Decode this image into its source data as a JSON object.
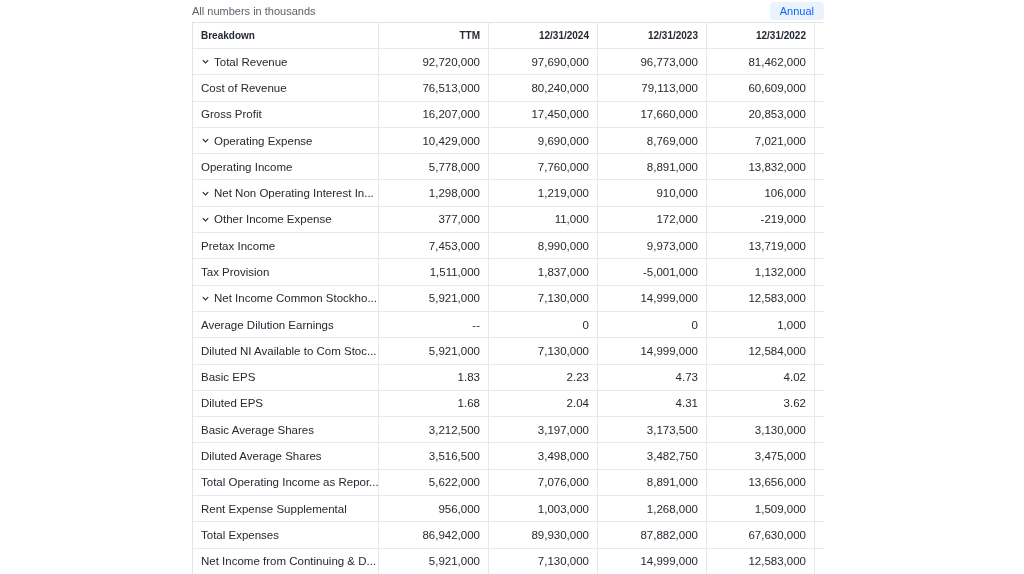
{
  "caption": "All numbers in thousands",
  "period_button": {
    "label": "Annual",
    "selected": true
  },
  "table": {
    "columns": [
      "Breakdown",
      "TTM",
      "12/31/2024",
      "12/31/2023",
      "12/31/2022"
    ],
    "rows": [
      {
        "label": "Total Revenue",
        "expandable": true,
        "values": [
          "92,720,000",
          "97,690,000",
          "96,773,000",
          "81,462,000"
        ]
      },
      {
        "label": "Cost of Revenue",
        "expandable": false,
        "values": [
          "76,513,000",
          "80,240,000",
          "79,113,000",
          "60,609,000"
        ]
      },
      {
        "label": "Gross Profit",
        "expandable": false,
        "values": [
          "16,207,000",
          "17,450,000",
          "17,660,000",
          "20,853,000"
        ]
      },
      {
        "label": "Operating Expense",
        "expandable": true,
        "values": [
          "10,429,000",
          "9,690,000",
          "8,769,000",
          "7,021,000"
        ]
      },
      {
        "label": "Operating Income",
        "expandable": false,
        "values": [
          "5,778,000",
          "7,760,000",
          "8,891,000",
          "13,832,000"
        ]
      },
      {
        "label": "Net Non Operating Interest In...",
        "expandable": true,
        "values": [
          "1,298,000",
          "1,219,000",
          "910,000",
          "106,000"
        ]
      },
      {
        "label": "Other Income Expense",
        "expandable": true,
        "values": [
          "377,000",
          "11,000",
          "172,000",
          "-219,000"
        ]
      },
      {
        "label": "Pretax Income",
        "expandable": false,
        "values": [
          "7,453,000",
          "8,990,000",
          "9,973,000",
          "13,719,000"
        ]
      },
      {
        "label": "Tax Provision",
        "expandable": false,
        "values": [
          "1,511,000",
          "1,837,000",
          "-5,001,000",
          "1,132,000"
        ]
      },
      {
        "label": "Net Income Common Stockho...",
        "expandable": true,
        "values": [
          "5,921,000",
          "7,130,000",
          "14,999,000",
          "12,583,000"
        ]
      },
      {
        "label": "Average Dilution Earnings",
        "expandable": false,
        "values": [
          "--",
          "0",
          "0",
          "1,000"
        ]
      },
      {
        "label": "Diluted NI Available to Com Stoc...",
        "expandable": false,
        "values": [
          "5,921,000",
          "7,130,000",
          "14,999,000",
          "12,584,000"
        ]
      },
      {
        "label": "Basic EPS",
        "expandable": false,
        "values": [
          "1.83",
          "2.23",
          "4.73",
          "4.02"
        ]
      },
      {
        "label": "Diluted EPS",
        "expandable": false,
        "values": [
          "1.68",
          "2.04",
          "4.31",
          "3.62"
        ]
      },
      {
        "label": "Basic Average Shares",
        "expandable": false,
        "values": [
          "3,212,500",
          "3,197,000",
          "3,173,500",
          "3,130,000"
        ]
      },
      {
        "label": "Diluted Average Shares",
        "expandable": false,
        "values": [
          "3,516,500",
          "3,498,000",
          "3,482,750",
          "3,475,000"
        ]
      },
      {
        "label": "Total Operating Income as Repor...",
        "expandable": false,
        "values": [
          "5,622,000",
          "7,076,000",
          "8,891,000",
          "13,656,000"
        ]
      },
      {
        "label": "Rent Expense Supplemental",
        "expandable": false,
        "values": [
          "956,000",
          "1,003,000",
          "1,268,000",
          "1,509,000"
        ]
      },
      {
        "label": "Total Expenses",
        "expandable": false,
        "values": [
          "86,942,000",
          "89,930,000",
          "87,882,000",
          "67,630,000"
        ]
      },
      {
        "label": "Net Income from Continuing & D...",
        "expandable": false,
        "values": [
          "5,921,000",
          "7,130,000",
          "14,999,000",
          "12,583,000"
        ]
      }
    ]
  }
}
